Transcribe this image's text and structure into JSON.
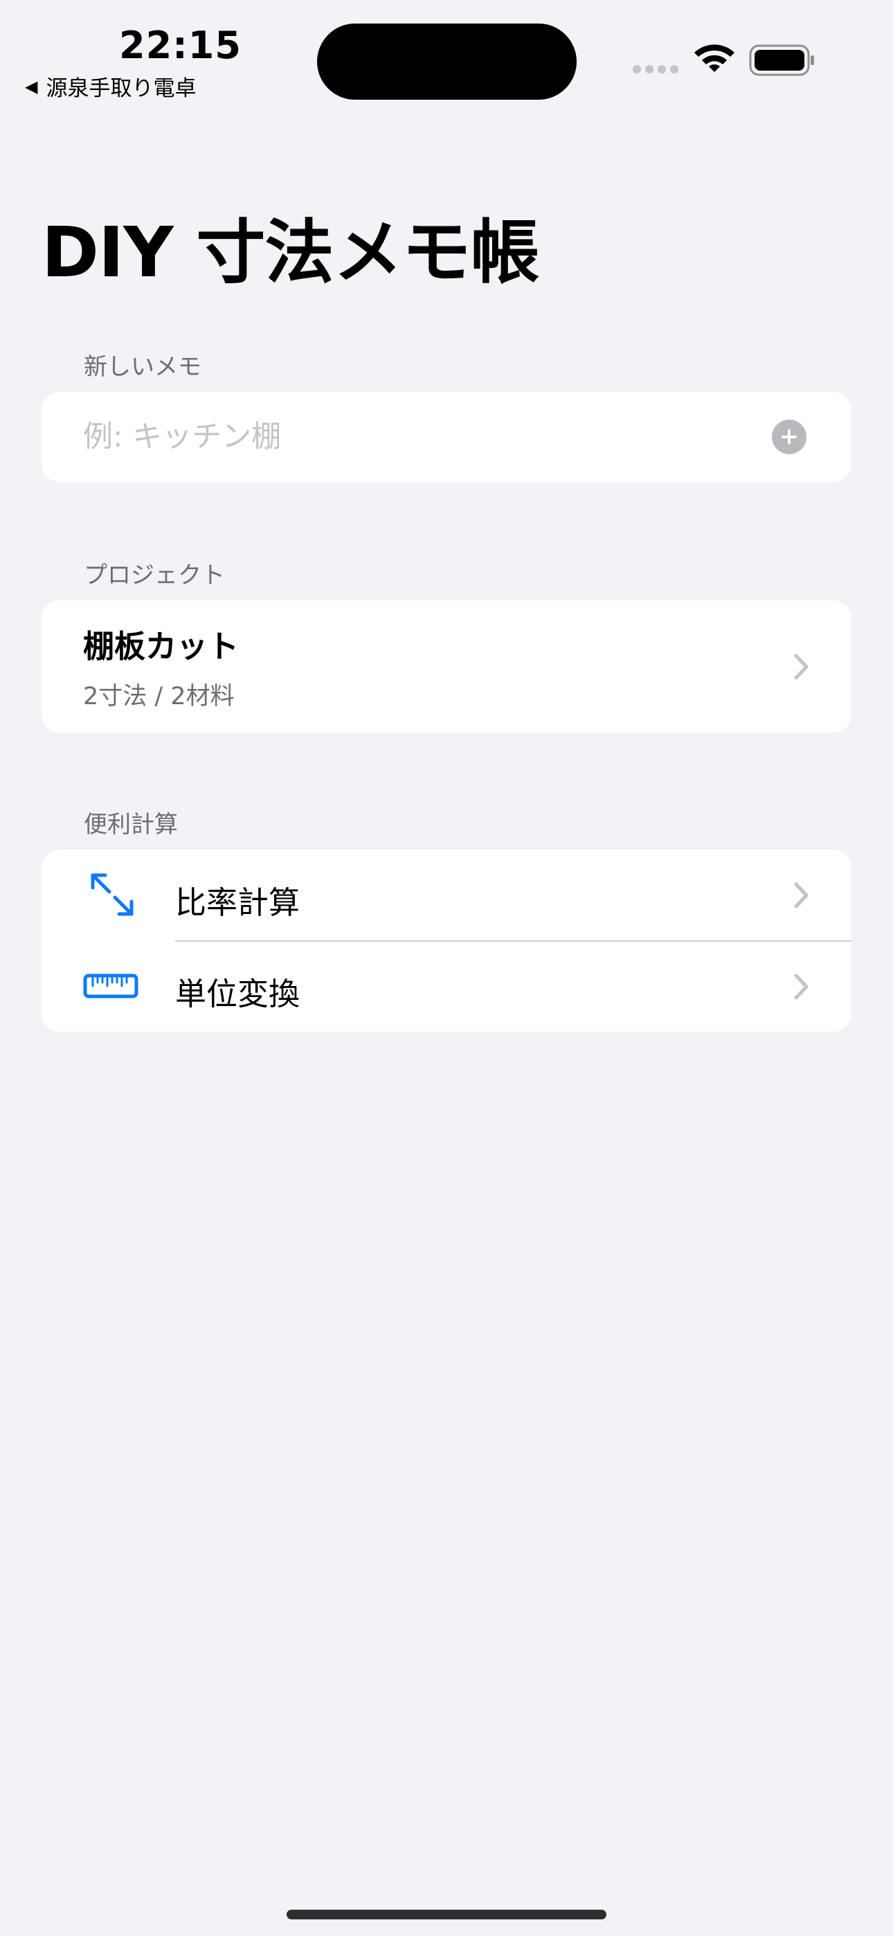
{
  "status_bar": {
    "time": "22:15",
    "back_label": "源泉手取り電卓",
    "back_arrow": "◀"
  },
  "page": {
    "title": "DIY 寸法メモ帳"
  },
  "new_memo": {
    "header": "新しいメモ",
    "placeholder": "例: キッチン棚",
    "value": ""
  },
  "projects": {
    "header": "プロジェクト",
    "items": [
      {
        "title": "棚板カット",
        "subtitle": "2寸法 / 2材料"
      }
    ]
  },
  "tools": {
    "header": "便利計算",
    "items": [
      {
        "label": "比率計算",
        "icon": "resize-arrows-icon"
      },
      {
        "label": "単位変換",
        "icon": "ruler-icon"
      }
    ]
  },
  "colors": {
    "background": "#F2F2F7",
    "card": "#FFFFFF",
    "accent": "#0A7AFF",
    "secondary_text": "#6D6D72",
    "placeholder": "#C4C4C7",
    "chevron": "#C4C4C7"
  }
}
